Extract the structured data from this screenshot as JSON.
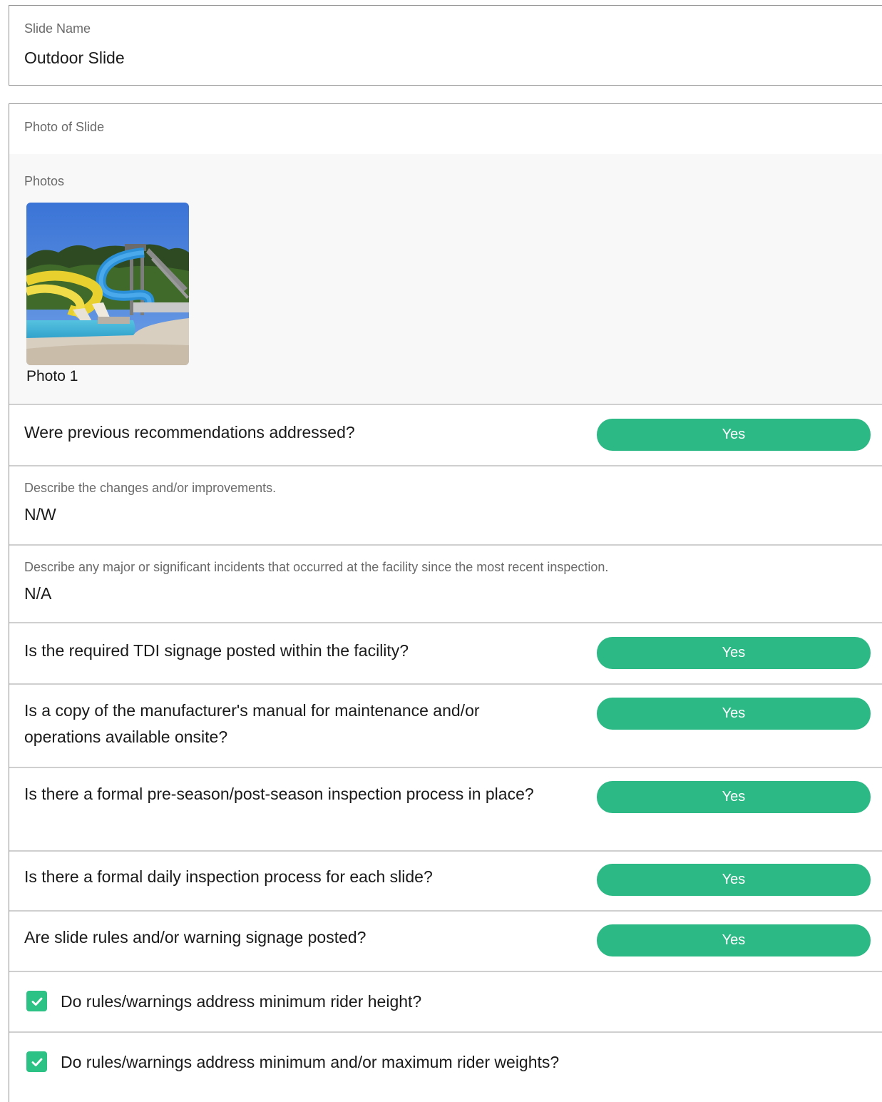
{
  "slide_name": {
    "label": "Slide Name",
    "value": "Outdoor Slide"
  },
  "photo_section": {
    "label": "Photo of Slide",
    "photos_label": "Photos",
    "photos": [
      {
        "caption": "Photo 1"
      }
    ]
  },
  "questions": [
    {
      "text": "Were previous recommendations addressed?",
      "answer": "Yes"
    }
  ],
  "describe_changes": {
    "label": "Describe the changes and/or improvements.",
    "value": "N/W"
  },
  "describe_incidents": {
    "label": "Describe any major or significant incidents that occurred at the facility since the most recent inspection.",
    "value": "N/A"
  },
  "more_questions": [
    {
      "text": "Is the required TDI signage posted within the facility?",
      "answer": "Yes"
    },
    {
      "text": "Is a copy of the manufacturer's manual for maintenance and/or operations available onsite?",
      "answer": "Yes"
    },
    {
      "text": "Is there a formal pre-season/post-season inspection process in place?",
      "answer": "Yes"
    },
    {
      "text": "Is there a formal daily inspection process for each slide?",
      "answer": "Yes"
    },
    {
      "text": "Are slide rules and/or warning signage posted?",
      "answer": "Yes"
    }
  ],
  "checklist": [
    {
      "text": "Do rules/warnings address minimum rider height?",
      "checked": true
    },
    {
      "text": "Do rules/warnings address minimum and/or maximum rider weights?",
      "checked": true
    }
  ],
  "colors": {
    "answer_button": "#2cb985",
    "checkbox": "#2cc185",
    "border": "#8f8f8f",
    "divider": "#cfcfcf"
  }
}
